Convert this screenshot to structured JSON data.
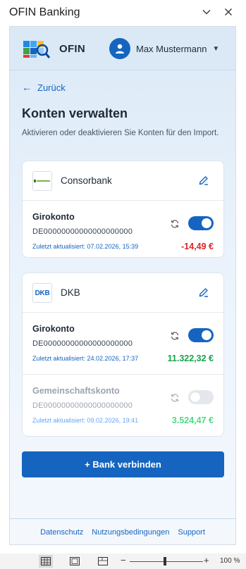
{
  "window": {
    "title": "OFIN Banking"
  },
  "header": {
    "brand": "OFIN",
    "user_name": "Max Mustermann",
    "user_caret": "▼"
  },
  "nav": {
    "back_arrow": "←",
    "back_label": "Zurück"
  },
  "page": {
    "title": "Konten verwalten",
    "description": "Aktivieren oder deaktivieren Sie Konten für den Import."
  },
  "banks": [
    {
      "name": "Consorbank",
      "accounts": [
        {
          "name": "Girokonto",
          "iban": "DE00000000000000000000",
          "updated": "Zuletzt aktualisiert: 07.02.2026, 15:39",
          "amount": "-14,49 €",
          "active": true
        }
      ]
    },
    {
      "name": "DKB",
      "logo_text": "DKB",
      "accounts": [
        {
          "name": "Girokonto",
          "iban": "DE00000000000000000000",
          "updated": "Zuletzt aktualisiert: 24.02.2026, 17:37",
          "amount": "11.322,32 €",
          "active": true
        },
        {
          "name": "Gemeinschaftskonto",
          "iban": "DE00000000000000000000",
          "updated": "Zuletzt aktualisiert: 09.02.2026, 19:41",
          "amount": "3.524,47 €",
          "active": false
        }
      ]
    }
  ],
  "actions": {
    "connect_label": "+ Bank verbinden"
  },
  "footer": {
    "privacy": "Datenschutz",
    "terms": "Nutzungsbedingungen",
    "support": "Support"
  },
  "statusbar": {
    "zoom_minus": "−",
    "zoom_plus": "+",
    "zoom": "100 %"
  },
  "colors": {
    "accent": "#1565c0",
    "negative": "#dc2626",
    "positive": "#16a34a"
  },
  "icons": {
    "chevron": "chevron-down-icon",
    "close": "close-icon",
    "user": "user-icon",
    "edit": "edit-icon",
    "sync": "sync-icon"
  }
}
